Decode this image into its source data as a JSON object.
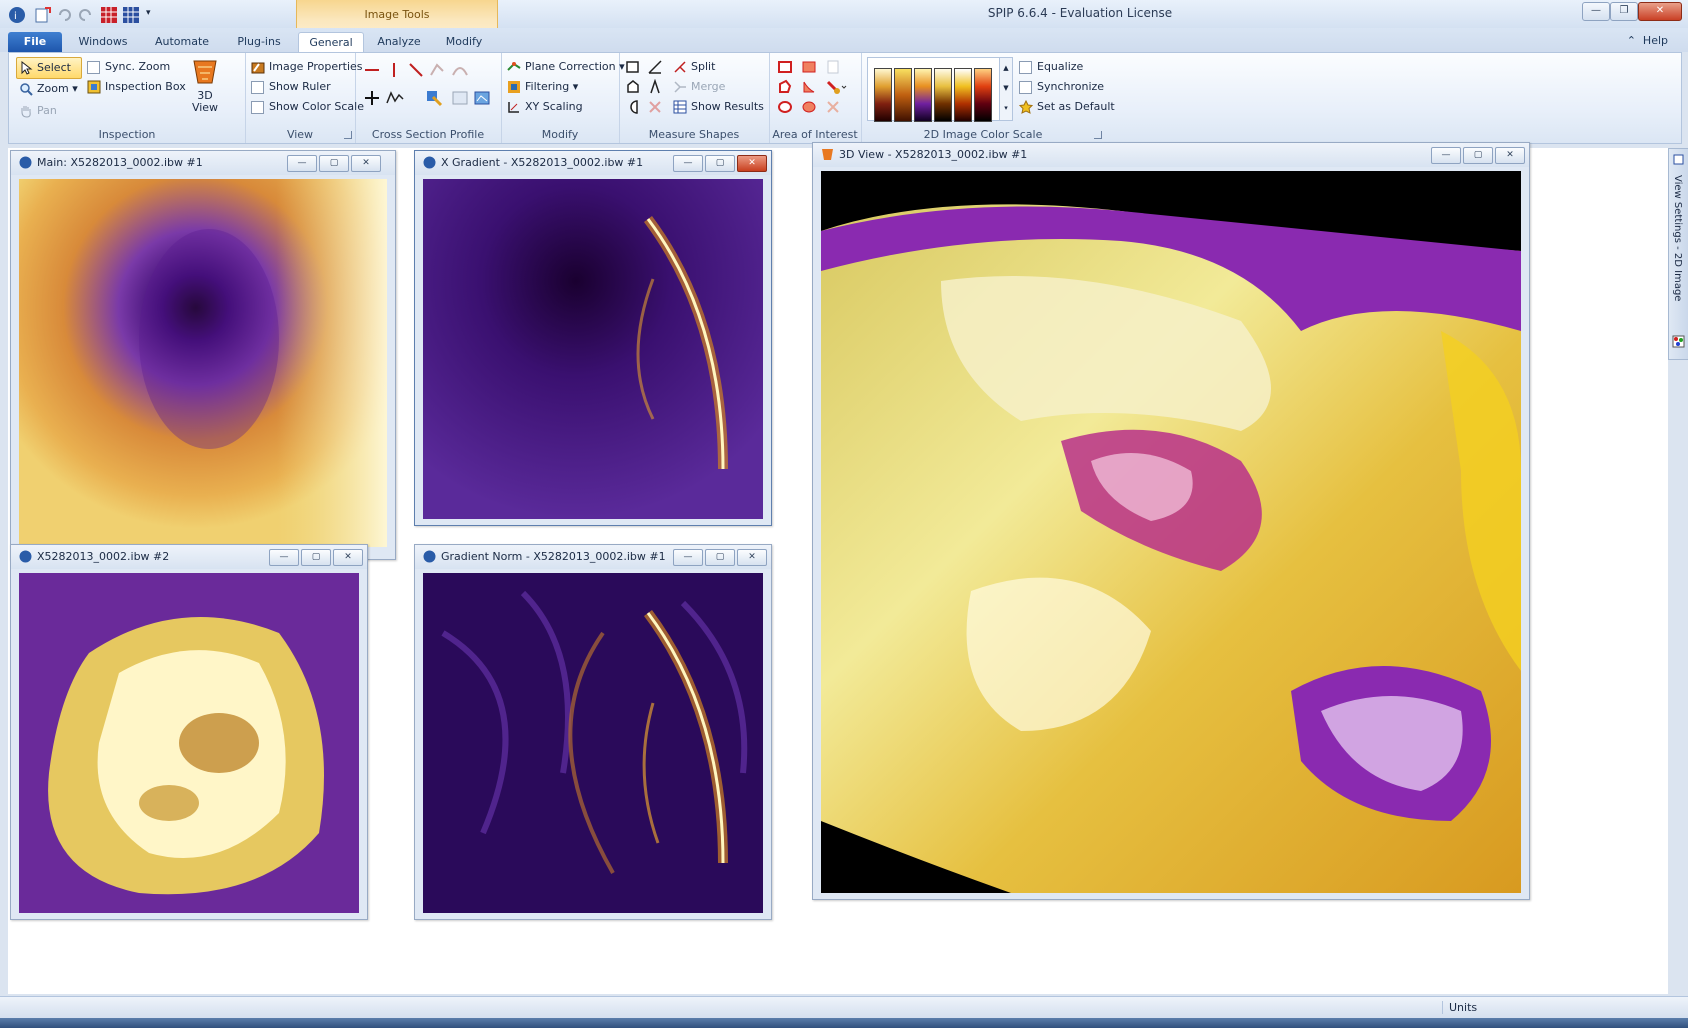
{
  "app": {
    "title": "SPIP 6.6.4 - Evaluation License",
    "contextual_tab_group": "Image Tools"
  },
  "tabs": {
    "file": "File",
    "windows": "Windows",
    "automate": "Automate",
    "plugins": "Plug-ins",
    "general": "General",
    "analyze": "Analyze",
    "modify": "Modify",
    "help": "Help"
  },
  "ribbon": {
    "inspection": {
      "label": "Inspection",
      "select": "Select",
      "zoom": "Zoom",
      "pan": "Pan",
      "sync_zoom": "Sync. Zoom",
      "inspection_box": "Inspection Box",
      "view3d": "3D\nView"
    },
    "view": {
      "label": "View",
      "image_properties": "Image Properties",
      "show_ruler": "Show Ruler",
      "show_color_scale": "Show Color Scale"
    },
    "cross_section": {
      "label": "Cross Section Profile"
    },
    "modify": {
      "label": "Modify",
      "plane_correction": "Plane Correction",
      "filtering": "Filtering",
      "xy_scaling": "XY Scaling"
    },
    "measure": {
      "label": "Measure Shapes",
      "split": "Split",
      "merge": "Merge",
      "show_results": "Show Results"
    },
    "aoi": {
      "label": "Area of Interest"
    },
    "colorscale": {
      "label": "2D Image Color Scale",
      "equalize": "Equalize",
      "synchronize": "Synchronize",
      "set_as_default": "Set as Default"
    }
  },
  "windows": {
    "main": "Main: X5282013_0002.ibw #1",
    "xgrad": "X Gradient - X5282013_0002.ibw #1",
    "copy2": "X5282013_0002.ibw #2",
    "gradnorm": "Gradient Norm - X5282013_0002.ibw #1",
    "view3d": "3D View - X5282013_0002.ibw #1"
  },
  "side_panel": {
    "label": "View Settings - 2D Image"
  },
  "status": {
    "units": "Units"
  },
  "colors": {
    "accent_blue": "#1e56ac",
    "contextual_orange": "#f7d68f",
    "map_dark": "#1a0026",
    "map_purple": "#6a1aa0",
    "map_orange": "#e0902a",
    "map_yellow": "#f3e07a",
    "map_white": "#fffbe8"
  }
}
